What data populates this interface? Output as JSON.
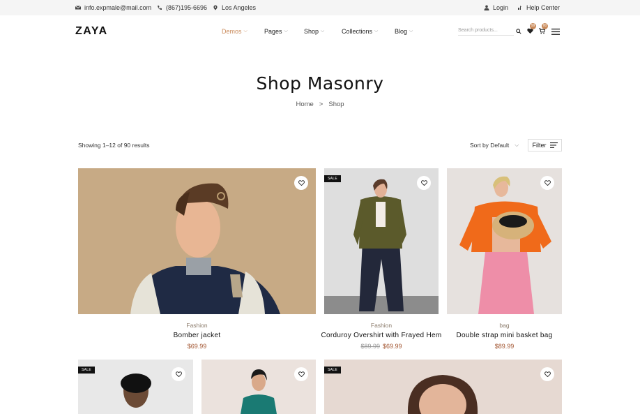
{
  "topbar": {
    "email": "info.expmale@mail.com",
    "phone": "(867)195-6696",
    "location": "Los Angeles",
    "login": "Login",
    "help": "Help Center"
  },
  "header": {
    "logo": "ZAYA",
    "nav": [
      "Demos",
      "Pages",
      "Shop",
      "Collections",
      "Blog"
    ],
    "search_placeholder": "Search products...",
    "wishlist_count": "99",
    "cart_count": "00"
  },
  "page": {
    "title": "Shop Masonry",
    "breadcrumb_home": "Home",
    "breadcrumb_sep": ">",
    "breadcrumb_current": "Shop"
  },
  "toolbar": {
    "results": "Showing 1–12 of 90 results",
    "sort": "Sort by Default",
    "filter": "Filter"
  },
  "products": [
    {
      "category": "Fashion",
      "name": "Bomber jacket",
      "price": "$69.99",
      "old_price": "",
      "sale": false
    },
    {
      "category": "Fashion",
      "name": "Corduroy Overshirt with Frayed Hem",
      "price": "$69.99",
      "old_price": "$89.99",
      "sale": true,
      "sale_label": "SALE"
    },
    {
      "category": "bag",
      "name": "Double strap mini basket bag",
      "price": "$89.99",
      "old_price": "",
      "sale": false
    }
  ],
  "row2": [
    {
      "sale": true,
      "sale_label": "SALE"
    },
    {
      "sale": false
    },
    {
      "sale": true,
      "sale_label": "SALE"
    }
  ],
  "colors": {
    "accent": "#c98a5a",
    "price": "#a0522d",
    "topbar_bg": "#f5f5f5",
    "sale_bg": "#111111"
  }
}
